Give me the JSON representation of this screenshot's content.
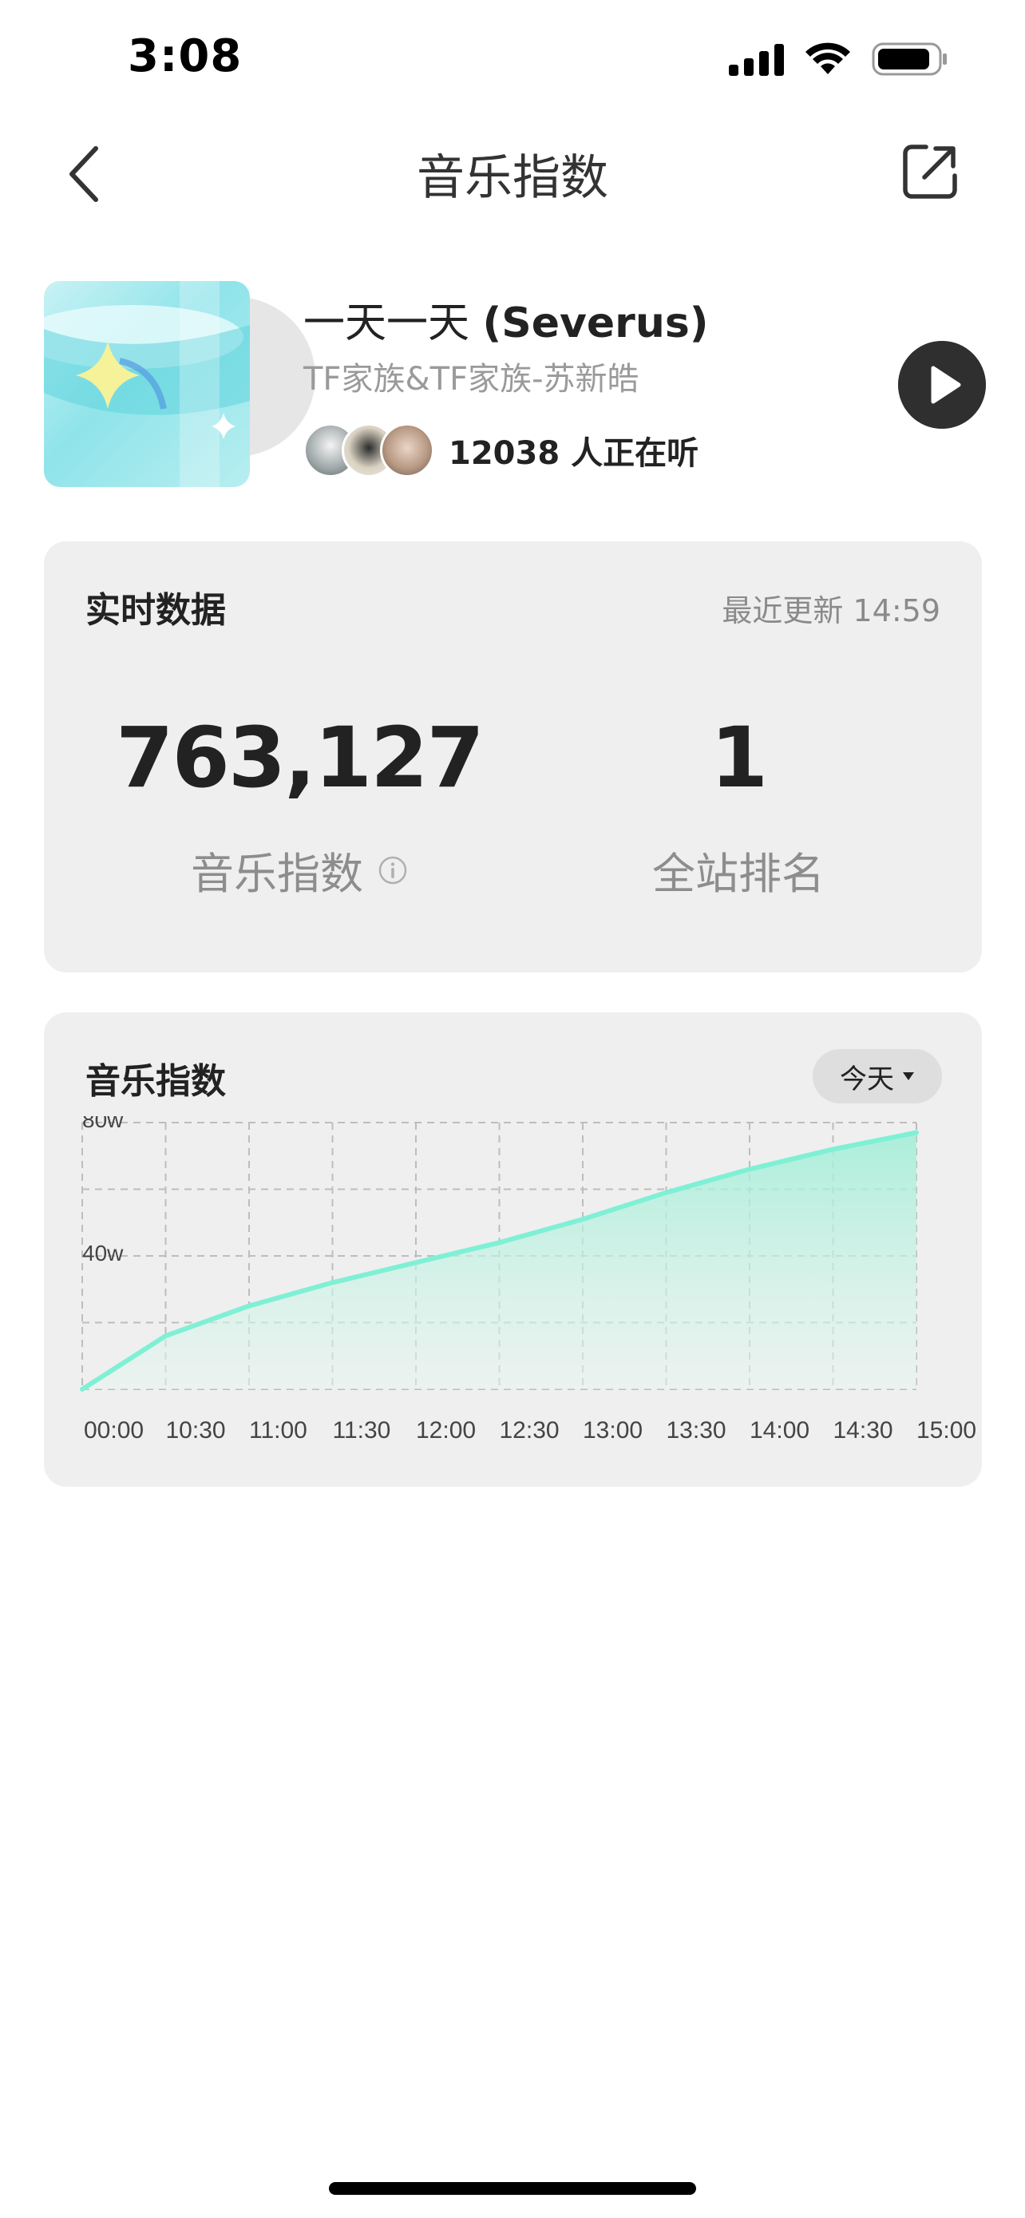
{
  "status_bar": {
    "time": "3:08"
  },
  "nav": {
    "title": "音乐指数"
  },
  "song": {
    "title_plain": "一天一天 ",
    "title_bold": "(Severus)",
    "artist": "TF家族&TF家族-苏新皓",
    "listeners_text": "12038 人正在听"
  },
  "realtime": {
    "title": "实时数据",
    "updated": "最近更新 14:59",
    "index_value": "763,127",
    "index_label": "音乐指数",
    "rank_value": "1",
    "rank_label": "全站排名"
  },
  "chart_card": {
    "title": "音乐指数",
    "range_label": "今天"
  },
  "chart_data": {
    "type": "area",
    "x": [
      "00:00",
      "10:30",
      "11:00",
      "11:30",
      "12:00",
      "12:30",
      "13:00",
      "13:30",
      "14:00",
      "14:30",
      "15:00"
    ],
    "xtick_labels": [
      "00:00",
      "10:30",
      "11:00",
      "11:30",
      "12:00",
      "12:30",
      "13:00",
      "13:30",
      "14:00",
      "14:30",
      "15:00"
    ],
    "series": [
      {
        "values": [
          0,
          160000,
          250000,
          320000,
          380000,
          440000,
          510000,
          590000,
          660000,
          720000,
          770000
        ]
      }
    ],
    "yticks": [
      "80w",
      "40w"
    ],
    "ylim": [
      0,
      800000
    ],
    "grid": true,
    "line_color": "#7ff0d5",
    "fill_color": "#bff0e0"
  },
  "colors": {
    "accent": "#7ff0d5",
    "card_bg": "#efefef",
    "play_button": "#2f2f2f"
  },
  "icons": [
    "back-chevron-icon",
    "share-icon",
    "play-icon",
    "info-icon",
    "dropdown-triangle-icon",
    "signal-icon",
    "wifi-icon",
    "battery-icon"
  ]
}
